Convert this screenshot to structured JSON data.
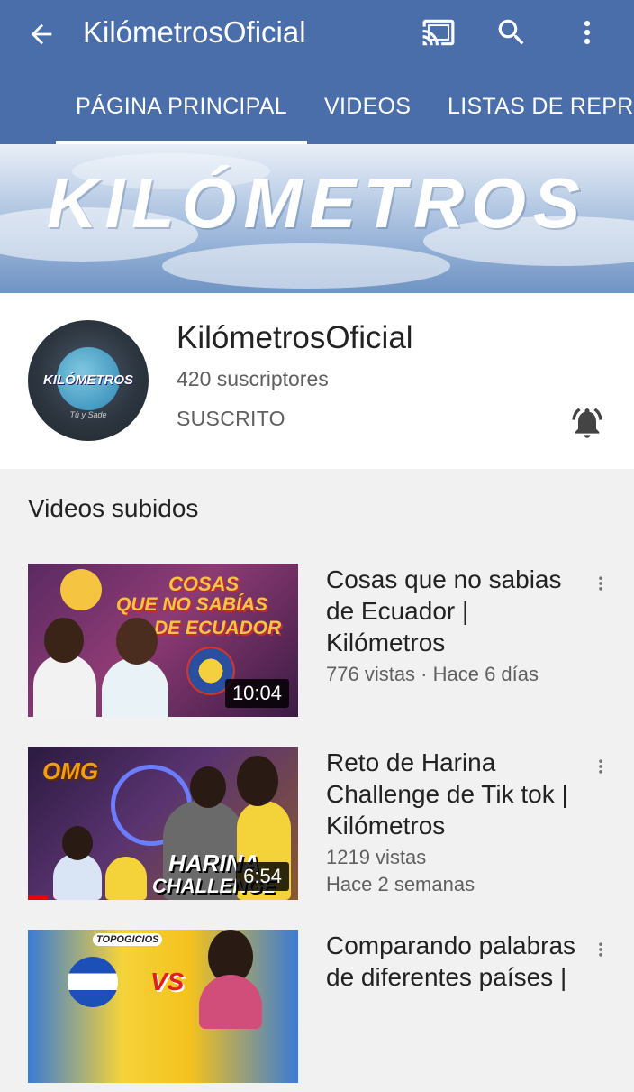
{
  "colors": {
    "topbar": "#4a6ea9",
    "card": "#ffffff",
    "background": "#f1f1f1",
    "text": "#222222",
    "secondary": "#606060"
  },
  "header": {
    "title": "KilómetrosOficial",
    "icons": {
      "back": "arrow-back-icon",
      "cast": "cast-icon",
      "search": "search-icon",
      "more": "more-vert-icon"
    }
  },
  "tabs": [
    {
      "label": "PÁGINA PRINCIPAL",
      "active": true
    },
    {
      "label": "VIDEOS",
      "active": false
    },
    {
      "label": "LISTAS DE REPRO",
      "active": false
    }
  ],
  "banner": {
    "text": "KILÓMETROS"
  },
  "channel": {
    "name": "KilómetrosOficial",
    "subscribers": "420 suscriptores",
    "subscribe_state": "SUSCRITO",
    "avatar_text": "KILÓMETROS",
    "avatar_subtext": "Tú y Sade",
    "bell_icon": "notifications-active-icon"
  },
  "section": {
    "title": "Videos subidos"
  },
  "videos": [
    {
      "title": "Cosas que no sabias de Ecuador | Kilómetros",
      "meta_line1": "776 vistas · Hace 6 días",
      "meta_line2": "",
      "duration": "10:04",
      "thumb_text1": "COSAS",
      "thumb_text2": "QUE NO SABÍAS",
      "thumb_text3": "DE ECUADOR"
    },
    {
      "title": "Reto de Harina Challenge de Tik tok | Kilómetros",
      "meta_line1": "1219 vistas",
      "meta_line2": "Hace 2 semanas",
      "duration": "6:54",
      "thumb_text1": "OMG",
      "thumb_text2": "HARINA",
      "thumb_text3": "CHALLENGE"
    },
    {
      "title": "Comparando palabras de diferentes países |",
      "meta_line1": "",
      "meta_line2": "",
      "duration": "",
      "thumb_text1": "TOPOGICIOS",
      "thumb_text2": "VS",
      "thumb_text3": ""
    }
  ]
}
